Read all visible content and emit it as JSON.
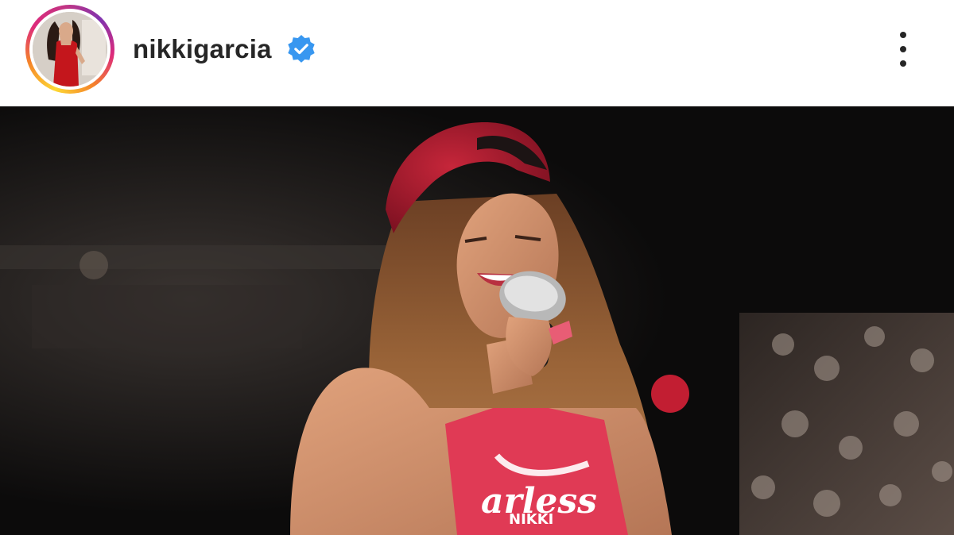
{
  "post": {
    "username": "nikkigarcia",
    "verified": true,
    "shirt_text_main": "arless",
    "shirt_text_sub": "NIKKI"
  },
  "icons": {
    "verified": "verified-badge-icon",
    "more": "more-options-icon"
  },
  "colors": {
    "verified_blue": "#3897f0",
    "username": "#262626",
    "ring_start": "#fdd835",
    "ring_end": "#c13584"
  }
}
